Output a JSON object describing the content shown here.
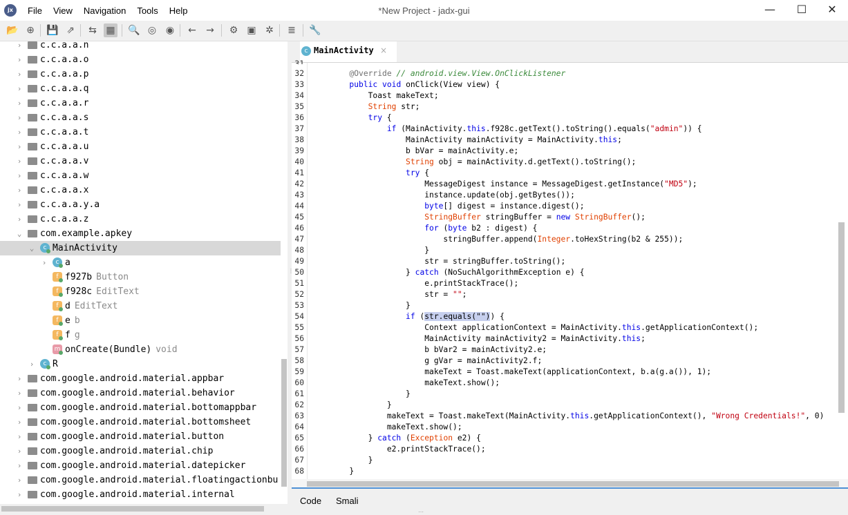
{
  "window": {
    "title": "*New Project - jadx-gui",
    "app_icon_text": "jx",
    "controls": {
      "minimize": "—",
      "maximize": "☐",
      "close": "✕"
    }
  },
  "menu": [
    "File",
    "View",
    "Navigation",
    "Tools",
    "Help"
  ],
  "toolbar": {
    "buttons": [
      "open-icon",
      "add-file-icon",
      "save-icon",
      "export-icon",
      "sync-icon",
      "flatten-icon",
      "search-icon",
      "find-class-icon",
      "find-usage-icon",
      "back-icon",
      "forward-icon",
      "deobfuscation-icon",
      "log-icon",
      "debug-icon",
      "summary-icon",
      "preferences-icon"
    ],
    "glyphs": {
      "open-icon": "📂",
      "add-file-icon": "⊕",
      "save-icon": "💾",
      "export-icon": "⇗",
      "sync-icon": "⇆",
      "flatten-icon": "▦",
      "search-icon": "🔍",
      "find-class-icon": "◎",
      "find-usage-icon": "◉",
      "back-icon": "←",
      "forward-icon": "→",
      "deobfuscation-icon": "⚙",
      "log-icon": "▣",
      "debug-icon": "✲",
      "summary-icon": "≣",
      "preferences-icon": "🔧"
    }
  },
  "tree": {
    "rows": [
      {
        "label": "c.c.a.a.n",
        "type": "package",
        "indent": 0,
        "arrow": "›"
      },
      {
        "label": "c.c.a.a.o",
        "type": "package",
        "indent": 0,
        "arrow": "›"
      },
      {
        "label": "c.c.a.a.p",
        "type": "package",
        "indent": 0,
        "arrow": "›"
      },
      {
        "label": "c.c.a.a.q",
        "type": "package",
        "indent": 0,
        "arrow": "›"
      },
      {
        "label": "c.c.a.a.r",
        "type": "package",
        "indent": 0,
        "arrow": "›"
      },
      {
        "label": "c.c.a.a.s",
        "type": "package",
        "indent": 0,
        "arrow": "›"
      },
      {
        "label": "c.c.a.a.t",
        "type": "package",
        "indent": 0,
        "arrow": "›"
      },
      {
        "label": "c.c.a.a.u",
        "type": "package",
        "indent": 0,
        "arrow": "›"
      },
      {
        "label": "c.c.a.a.v",
        "type": "package",
        "indent": 0,
        "arrow": "›"
      },
      {
        "label": "c.c.a.a.w",
        "type": "package",
        "indent": 0,
        "arrow": "›"
      },
      {
        "label": "c.c.a.a.x",
        "type": "package",
        "indent": 0,
        "arrow": "›"
      },
      {
        "label": "c.c.a.a.y.a",
        "type": "package",
        "indent": 0,
        "arrow": "›"
      },
      {
        "label": "c.c.a.a.z",
        "type": "package",
        "indent": 0,
        "arrow": "›"
      },
      {
        "label": "com.example.apkey",
        "type": "package",
        "indent": 0,
        "arrow": "⌄"
      },
      {
        "label": "MainActivity",
        "type": "class",
        "indent": 1,
        "arrow": "⌄",
        "selected": true
      },
      {
        "label": "a",
        "type": "class",
        "indent": 2,
        "arrow": "›"
      },
      {
        "label": "f927b",
        "hint": "Button",
        "type": "field",
        "indent": 2,
        "arrow": ""
      },
      {
        "label": "f928c",
        "hint": "EditText",
        "type": "field",
        "indent": 2,
        "arrow": ""
      },
      {
        "label": "d",
        "hint": "EditText",
        "type": "field",
        "indent": 2,
        "arrow": ""
      },
      {
        "label": "e",
        "hint": "b",
        "type": "field",
        "indent": 2,
        "arrow": ""
      },
      {
        "label": "f",
        "hint": "g",
        "type": "field",
        "indent": 2,
        "arrow": ""
      },
      {
        "label": "onCreate(Bundle)",
        "hint": "void",
        "type": "method",
        "indent": 2,
        "arrow": ""
      },
      {
        "label": "R",
        "type": "class",
        "indent": 1,
        "arrow": "›"
      },
      {
        "label": "com.google.android.material.appbar",
        "type": "package",
        "indent": 0,
        "arrow": "›"
      },
      {
        "label": "com.google.android.material.behavior",
        "type": "package",
        "indent": 0,
        "arrow": "›"
      },
      {
        "label": "com.google.android.material.bottomappbar",
        "type": "package",
        "indent": 0,
        "arrow": "›"
      },
      {
        "label": "com.google.android.material.bottomsheet",
        "type": "package",
        "indent": 0,
        "arrow": "›"
      },
      {
        "label": "com.google.android.material.button",
        "type": "package",
        "indent": 0,
        "arrow": "›"
      },
      {
        "label": "com.google.android.material.chip",
        "type": "package",
        "indent": 0,
        "arrow": "›"
      },
      {
        "label": "com.google.android.material.datepicker",
        "type": "package",
        "indent": 0,
        "arrow": "›"
      },
      {
        "label": "com.google.android.material.floatingactionbu",
        "type": "package",
        "indent": 0,
        "arrow": "›"
      },
      {
        "label": "com.google.android.material.internal",
        "type": "package",
        "indent": 0,
        "arrow": "›"
      }
    ]
  },
  "editor": {
    "tab_label": "MainActivity",
    "tab_icon_text": "c",
    "tab_close": "×",
    "top_partial_line": "31",
    "lines": [
      {
        "n": "32",
        "segs": [
          [
            "        ",
            ""
          ],
          [
            "@Override",
            "an"
          ],
          [
            " // android.view.View.OnClickListener",
            "cm"
          ]
        ]
      },
      {
        "n": "33",
        "segs": [
          [
            "        ",
            ""
          ],
          [
            "public",
            "kw"
          ],
          [
            " ",
            ""
          ],
          [
            "void",
            "kw"
          ],
          [
            " onClick(View view) {",
            ""
          ]
        ]
      },
      {
        "n": "34",
        "segs": [
          [
            "            Toast makeText;",
            ""
          ]
        ]
      },
      {
        "n": "35",
        "segs": [
          [
            "            ",
            ""
          ],
          [
            "String",
            "ty"
          ],
          [
            " str;",
            ""
          ]
        ]
      },
      {
        "n": "36",
        "segs": [
          [
            "            ",
            ""
          ],
          [
            "try",
            "kw"
          ],
          [
            " {",
            ""
          ]
        ]
      },
      {
        "n": "37",
        "segs": [
          [
            "                ",
            ""
          ],
          [
            "if",
            "kw"
          ],
          [
            " (MainActivity.",
            ""
          ],
          [
            "this",
            "kw"
          ],
          [
            ".f928c.getText().toString().equals(",
            ""
          ],
          [
            "\"admin\"",
            "st"
          ],
          [
            ")) {",
            ""
          ]
        ]
      },
      {
        "n": "38",
        "segs": [
          [
            "                    MainActivity mainActivity = MainActivity.",
            ""
          ],
          [
            "this",
            "kw"
          ],
          [
            ";",
            ""
          ]
        ]
      },
      {
        "n": "39",
        "segs": [
          [
            "                    b bVar = mainActivity.e;",
            ""
          ]
        ]
      },
      {
        "n": "40",
        "segs": [
          [
            "                    ",
            ""
          ],
          [
            "String",
            "ty"
          ],
          [
            " obj = mainActivity.d.getText().toString();",
            ""
          ]
        ]
      },
      {
        "n": "41",
        "segs": [
          [
            "                    ",
            ""
          ],
          [
            "try",
            "kw"
          ],
          [
            " {",
            ""
          ]
        ]
      },
      {
        "n": "42",
        "segs": [
          [
            "                        MessageDigest instance = MessageDigest.getInstance(",
            ""
          ],
          [
            "\"MD5\"",
            "st"
          ],
          [
            ");",
            ""
          ]
        ]
      },
      {
        "n": "43",
        "segs": [
          [
            "                        instance.update(obj.getBytes());",
            ""
          ]
        ]
      },
      {
        "n": "44",
        "segs": [
          [
            "                        ",
            ""
          ],
          [
            "byte",
            "kw"
          ],
          [
            "[] digest = instance.digest();",
            ""
          ]
        ]
      },
      {
        "n": "45",
        "segs": [
          [
            "                        ",
            ""
          ],
          [
            "StringBuffer",
            "ty"
          ],
          [
            " stringBuffer = ",
            ""
          ],
          [
            "new",
            "kw"
          ],
          [
            " ",
            ""
          ],
          [
            "StringBuffer",
            "ty"
          ],
          [
            "();",
            ""
          ]
        ]
      },
      {
        "n": "46",
        "segs": [
          [
            "                        ",
            ""
          ],
          [
            "for",
            "kw"
          ],
          [
            " (",
            ""
          ],
          [
            "byte",
            "kw"
          ],
          [
            " b2 : digest) {",
            ""
          ]
        ]
      },
      {
        "n": "47",
        "segs": [
          [
            "                            stringBuffer.append(",
            ""
          ],
          [
            "Integer",
            "ty"
          ],
          [
            ".toHexString(b2 & 255));",
            ""
          ]
        ]
      },
      {
        "n": "48",
        "segs": [
          [
            "                        }",
            ""
          ]
        ]
      },
      {
        "n": "49",
        "segs": [
          [
            "                        str = stringBuffer.toString();",
            ""
          ]
        ]
      },
      {
        "n": "50",
        "segs": [
          [
            "                    } ",
            ""
          ],
          [
            "catch",
            "kw"
          ],
          [
            " (NoSuchAlgorithmException e) {",
            ""
          ]
        ]
      },
      {
        "n": "51",
        "segs": [
          [
            "                        e.printStackTrace();",
            ""
          ]
        ]
      },
      {
        "n": "52",
        "segs": [
          [
            "                        str = ",
            ""
          ],
          [
            "\"\"",
            "st"
          ],
          [
            ";",
            ""
          ]
        ]
      },
      {
        "n": "53",
        "segs": [
          [
            "                    }",
            ""
          ]
        ]
      },
      {
        "n": "54",
        "segs": [
          [
            "                    ",
            ""
          ],
          [
            "if",
            "kw"
          ],
          [
            " (",
            ""
          ],
          [
            "str.equals(\"\")",
            "hl"
          ],
          [
            ") {",
            ""
          ]
        ]
      },
      {
        "n": "55",
        "segs": [
          [
            "                        Context applicationContext = MainActivity.",
            ""
          ],
          [
            "this",
            "kw"
          ],
          [
            ".getApplicationContext();",
            ""
          ]
        ]
      },
      {
        "n": "56",
        "segs": [
          [
            "                        MainActivity mainActivity2 = MainActivity.",
            ""
          ],
          [
            "this",
            "kw"
          ],
          [
            ";",
            ""
          ]
        ]
      },
      {
        "n": "57",
        "segs": [
          [
            "                        b bVar2 = mainActivity2.e;",
            ""
          ]
        ]
      },
      {
        "n": "58",
        "segs": [
          [
            "                        g gVar = mainActivity2.f;",
            ""
          ]
        ]
      },
      {
        "n": "59",
        "segs": [
          [
            "                        makeText = Toast.makeText(applicationContext, b.a(g.a()), 1);",
            ""
          ]
        ]
      },
      {
        "n": "60",
        "segs": [
          [
            "                        makeText.show();",
            ""
          ]
        ]
      },
      {
        "n": "61",
        "segs": [
          [
            "                    }",
            ""
          ]
        ]
      },
      {
        "n": "62",
        "segs": [
          [
            "                }",
            ""
          ]
        ]
      },
      {
        "n": "63",
        "segs": [
          [
            "                makeText = Toast.makeText(MainActivity.",
            ""
          ],
          [
            "this",
            "kw"
          ],
          [
            ".getApplicationContext(), ",
            ""
          ],
          [
            "\"Wrong Credentials!\"",
            "st"
          ],
          [
            ", 0)",
            ""
          ]
        ]
      },
      {
        "n": "64",
        "segs": [
          [
            "                makeText.show();",
            ""
          ]
        ]
      },
      {
        "n": "65",
        "segs": [
          [
            "            } ",
            ""
          ],
          [
            "catch",
            "kw"
          ],
          [
            " (",
            ""
          ],
          [
            "Exception",
            "ty"
          ],
          [
            " e2) {",
            ""
          ]
        ]
      },
      {
        "n": "66",
        "segs": [
          [
            "                e2.printStackTrace();",
            ""
          ]
        ]
      },
      {
        "n": "67",
        "segs": [
          [
            "            }",
            ""
          ]
        ]
      },
      {
        "n": "68",
        "segs": [
          [
            "        }",
            ""
          ]
        ]
      }
    ],
    "bottom_tabs": [
      "Code",
      "Smali"
    ]
  }
}
